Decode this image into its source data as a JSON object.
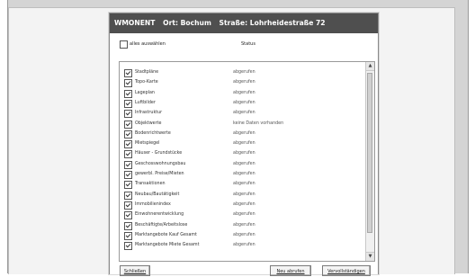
{
  "dialog": {
    "title_app": "WMONENT",
    "title_ort": "Ort: Bochum",
    "title_strasse": "Straße: Lohrheidestraße 72"
  },
  "header": {
    "select_all_label": "alles auswählen",
    "select_all_checked": false,
    "status_column": "Status"
  },
  "items": [
    {
      "label": "Stadtpläne",
      "status": "abgerufen",
      "checked": true
    },
    {
      "label": "Topo-Karte",
      "status": "abgerufen",
      "checked": true
    },
    {
      "label": "Lageplan",
      "status": "abgerufen",
      "checked": true
    },
    {
      "label": "Luftbilder",
      "status": "abgerufen",
      "checked": true
    },
    {
      "label": "Infrastruktur",
      "status": "abgerufen",
      "checked": true
    },
    {
      "label": "Objektwerte",
      "status": "keine Daten vorhanden",
      "checked": true
    },
    {
      "label": "Bodenrichtwerte",
      "status": "abgerufen",
      "checked": true
    },
    {
      "label": "Mietspiegel",
      "status": "abgerufen",
      "checked": true
    },
    {
      "label": "Häuser - Grundstücke",
      "status": "abgerufen",
      "checked": true
    },
    {
      "label": "Geschosswohnungsbau",
      "status": "abgerufen",
      "checked": true
    },
    {
      "label": "gewerbl. Preise/Mieten",
      "status": "abgerufen",
      "checked": true
    },
    {
      "label": "Transaktionen",
      "status": "abgerufen",
      "checked": true
    },
    {
      "label": "Neubau/Bautätigkeit",
      "status": "abgerufen",
      "checked": true
    },
    {
      "label": "Immobilienindex",
      "status": "abgerufen",
      "checked": true
    },
    {
      "label": "Einwohnerentwicklung",
      "status": "abgerufen",
      "checked": true
    },
    {
      "label": "Beschäftigte/Arbeitslose",
      "status": "abgerufen",
      "checked": true
    },
    {
      "label": "Marktangebote Kauf Gesamt",
      "status": "abgerufen",
      "checked": true
    },
    {
      "label": "Marktangebote Miete Gesamt",
      "status": "abgerufen",
      "checked": true
    }
  ],
  "buttons": {
    "close": "Schließen",
    "reload": "Neu abrufen",
    "complete": "Vervollständigen"
  }
}
